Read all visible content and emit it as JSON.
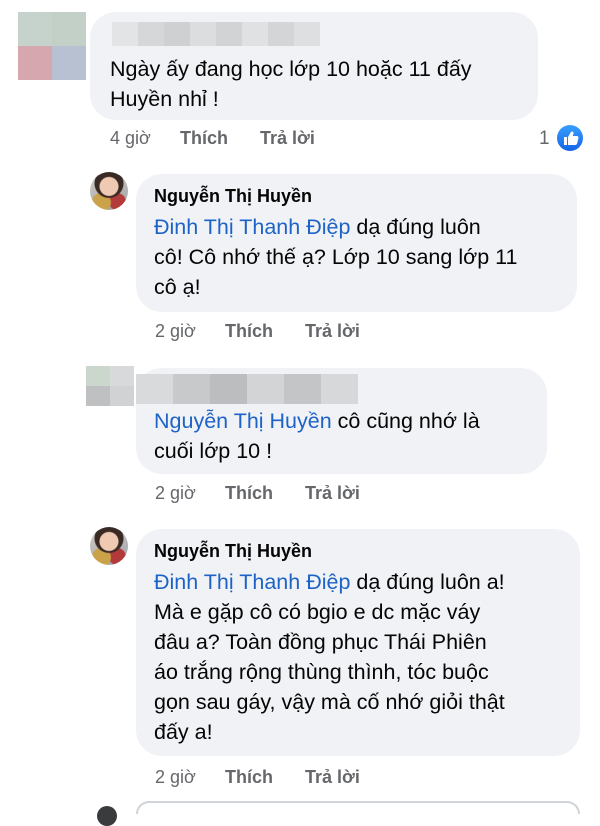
{
  "thread": {
    "comments": [
      {
        "author": "",
        "text_lines": [
          "Ngày ấy đang học lớp 10 hoặc 11 đấy",
          "Huyền nhỉ !"
        ],
        "time": "4 giờ",
        "like_label": "Thích",
        "reply_label": "Trả lời",
        "reaction_count": "1"
      },
      {
        "author": "Nguyễn Thị Huyền",
        "mention": "Đinh Thị Thanh Điệp",
        "text_lines": [
          " dạ đúng luôn",
          "cô! Cô nhớ thế ạ? Lớp 10 sang lớp 11",
          "cô ạ!"
        ],
        "time": "2 giờ",
        "like_label": "Thích",
        "reply_label": "Trả lời"
      },
      {
        "author": "",
        "mention": "Nguyễn Thị Huyền",
        "text_lines": [
          " cô cũng nhớ là",
          "cuối lớp 10 !"
        ],
        "time": "2 giờ",
        "like_label": "Thích",
        "reply_label": "Trả lời"
      },
      {
        "author": "Nguyễn Thị Huyền",
        "mention": "Đinh Thị Thanh Điệp",
        "text_lines": [
          " dạ đúng luôn a!",
          "Mà e gặp cô có bgio e dc mặc váy",
          "đâu a? Toàn đồng phục Thái Phiên",
          "áo trắng rộng thùng thình, tóc buộc",
          "gọn sau gáy, vậy mà cố nhớ giỏi thật",
          "đấy a!"
        ],
        "time": "2 giờ",
        "like_label": "Thích",
        "reply_label": "Trả lời"
      }
    ]
  },
  "icons": {
    "like_badge": "thumbs-up-icon",
    "blurred_avatar": "pixelated-avatar",
    "blurred_name": "pixelated-name"
  },
  "colors": {
    "mention": "#1d63c7",
    "bubble": "#f0f2f5",
    "meta_text": "#65676b",
    "like_blue": "#1877f2"
  }
}
